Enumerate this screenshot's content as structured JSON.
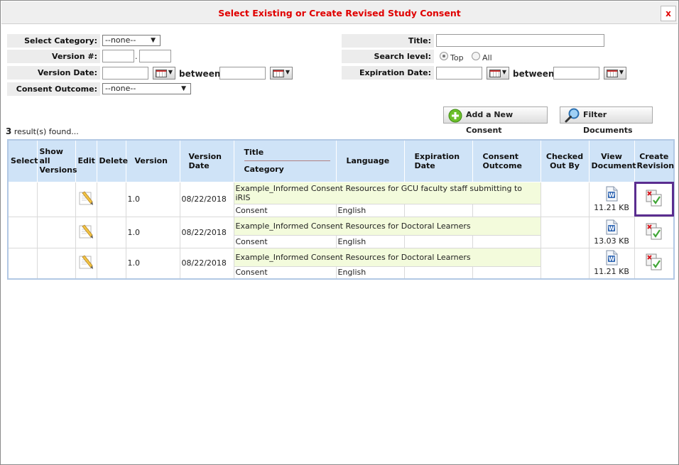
{
  "dialog": {
    "title": "Select Existing or Create Revised Study Consent",
    "close_label": "x"
  },
  "filters": {
    "category_label": "Select Category:",
    "category_value": "--none--",
    "version_label": "Version #:",
    "version_dot": ".",
    "version_date_label": "Version Date:",
    "between_label": "between",
    "consent_outcome_label": "Consent Outcome:",
    "consent_outcome_value": "--none--",
    "title_label": "Title:",
    "search_level_label": "Search level:",
    "search_level_options": [
      "Top",
      "All"
    ],
    "expiration_date_label": "Expiration Date:"
  },
  "buttons": {
    "add_new": "Add a New Consent",
    "filter": "Filter Documents"
  },
  "results": {
    "count": "3",
    "suffix": " result(s) found..."
  },
  "table": {
    "headers": {
      "select": "Select",
      "show_all_versions": "Show all Versions",
      "edit": "Edit",
      "delete": "Delete",
      "version": "Version",
      "version_date": "Version Date",
      "title": "Title",
      "category": "Category",
      "language": "Language",
      "expiration_date": "Expiration Date",
      "consent_outcome": "Consent Outcome",
      "checked_out_by": "Checked Out By",
      "view_document": "View Document",
      "create_revision": "Create Revision"
    },
    "rows": [
      {
        "version": "1.0",
        "version_date": "08/22/2018",
        "title": "Example_Informed Consent Resources for GCU faculty staff submitting to iRIS",
        "category": "Consent",
        "language": "English",
        "size": "11.21 KB"
      },
      {
        "version": "1.0",
        "version_date": "08/22/2018",
        "title": "Example_Informed Consent Resources for Doctoral Learners",
        "category": "Consent",
        "language": "English",
        "size": "13.03 KB"
      },
      {
        "version": "1.0",
        "version_date": "08/22/2018",
        "title": "Example_Informed Consent Resources for Doctoral Learners",
        "category": "Consent",
        "language": "English",
        "size": "11.21 KB"
      }
    ]
  },
  "colors": {
    "title_red": "#e00000",
    "header_blue": "#cfe3f7",
    "title_cell_green": "#f3fbdc",
    "highlight_purple": "#5a2d8f"
  }
}
